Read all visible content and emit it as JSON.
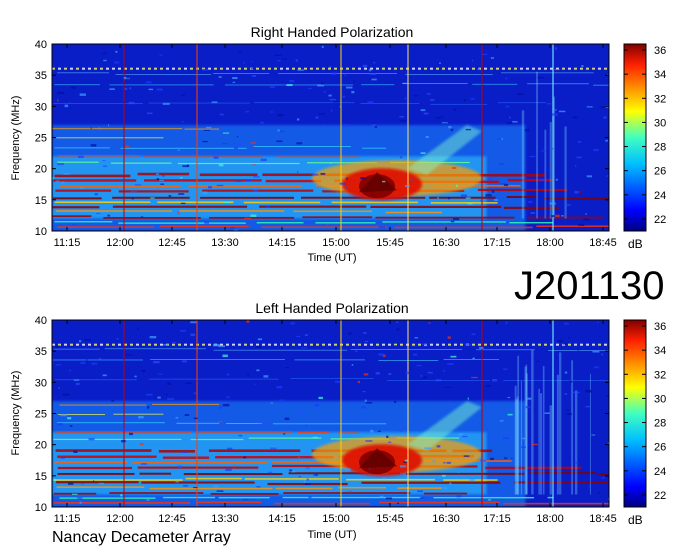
{
  "session_label": "J201130",
  "instrument_label": "Nancay Decameter Array",
  "chart_data": [
    {
      "type": "heatmap",
      "title": "Right Handed Polarization",
      "xlabel": "Time (UT)",
      "ylabel": "Frequency (MHz)",
      "x_ticks": [
        "11:15",
        "12:00",
        "12:45",
        "13:30",
        "14:15",
        "15:00",
        "15:45",
        "16:30",
        "17:15",
        "18:00",
        "18:45"
      ],
      "y_ticks": [
        10,
        15,
        20,
        25,
        30,
        35,
        40
      ],
      "ylim": [
        10,
        40
      ],
      "colorbar": {
        "label": "dB",
        "ticks": [
          22,
          24,
          26,
          28,
          30,
          32,
          34,
          36
        ],
        "range": [
          21,
          36.5
        ]
      },
      "colormap": "jet",
      "grid": false
    },
    {
      "type": "heatmap",
      "title": "Left Handed Polarization",
      "xlabel": "Time (UT)",
      "ylabel": "Frequency (MHz)",
      "x_ticks": [
        "11:15",
        "12:00",
        "12:45",
        "13:30",
        "14:15",
        "15:00",
        "15:45",
        "16:30",
        "17:15",
        "18:00",
        "18:45"
      ],
      "y_ticks": [
        10,
        15,
        20,
        25,
        30,
        35,
        40
      ],
      "ylim": [
        10,
        40
      ],
      "colorbar": {
        "label": "dB",
        "ticks": [
          22,
          24,
          26,
          28,
          30,
          32,
          34,
          36
        ],
        "range": [
          21,
          36.5
        ]
      },
      "colormap": "jet",
      "grid": false
    }
  ]
}
